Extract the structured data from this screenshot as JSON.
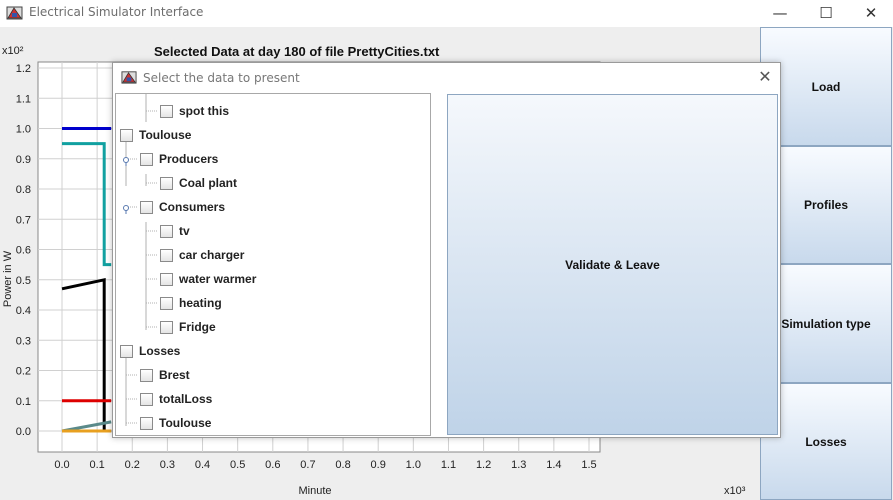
{
  "window": {
    "title": "Electrical Simulator Interface",
    "minimize": "—",
    "maximize": "☐",
    "close": "✕"
  },
  "plot": {
    "title": "Selected Data at day 180 of file PrettyCities.txt",
    "y_exponent": "x10²",
    "x_exponent": "x10³",
    "ylabel": "Power in W",
    "xlabel": "Minute",
    "y_ticks": [
      "1.2",
      "1.1",
      "1.0",
      "0.9",
      "0.8",
      "0.7",
      "0.6",
      "0.5",
      "0.4",
      "0.3",
      "0.2",
      "0.1",
      "0.0"
    ],
    "x_ticks": [
      "0.0",
      "0.1",
      "0.2",
      "0.3",
      "0.4",
      "0.5",
      "0.6",
      "0.7",
      "0.8",
      "0.9",
      "1.0",
      "1.1",
      "1.2",
      "1.3",
      "1.4",
      "1.5"
    ]
  },
  "chart_data": {
    "type": "line",
    "title": "Selected Data at day 180 of file PrettyCities.txt",
    "xlabel": "Minute",
    "ylabel": "Power in W",
    "x_scale": "x10^3",
    "y_scale": "x10^2",
    "xlim": [
      0,
      1.5
    ],
    "ylim": [
      0,
      1.2
    ],
    "grid": true,
    "series": [
      {
        "color": "#0000cc",
        "points": [
          [
            0,
            1.0
          ],
          [
            0.14,
            1.0
          ]
        ]
      },
      {
        "color": "#11a0a0",
        "points": [
          [
            0,
            0.95
          ],
          [
            0.12,
            0.95
          ],
          [
            0.12,
            0.55
          ],
          [
            0.14,
            0.55
          ]
        ]
      },
      {
        "color": "#000000",
        "points": [
          [
            0,
            0.47
          ],
          [
            0.12,
            0.5
          ],
          [
            0.12,
            0.0
          ],
          [
            0.14,
            0.0
          ]
        ]
      },
      {
        "color": "#dd0000",
        "points": [
          [
            0,
            0.1
          ],
          [
            0.14,
            0.1
          ]
        ]
      },
      {
        "color": "#5a8a8a",
        "points": [
          [
            0,
            0.0
          ],
          [
            0.14,
            0.03
          ]
        ]
      },
      {
        "color": "#e8a020",
        "points": [
          [
            0,
            0.0
          ],
          [
            0.14,
            0.0
          ]
        ]
      }
    ]
  },
  "sidebar": {
    "load": "Load",
    "profiles": "Profiles",
    "simulation_type": "Simulation type",
    "losses": "Losses"
  },
  "dialog": {
    "title": "Select the data to present",
    "close": "✕",
    "validate": "Validate & Leave",
    "tree": [
      {
        "label": "spot this",
        "level": 2
      },
      {
        "label": "Toulouse",
        "level": 0
      },
      {
        "label": "Producers",
        "level": 1
      },
      {
        "label": "Coal plant",
        "level": 2
      },
      {
        "label": "Consumers",
        "level": 1
      },
      {
        "label": "tv",
        "level": 2
      },
      {
        "label": "car charger",
        "level": 2
      },
      {
        "label": "water warmer",
        "level": 2
      },
      {
        "label": "heating",
        "level": 2
      },
      {
        "label": "Fridge",
        "level": 2
      },
      {
        "label": "Losses",
        "level": 0
      },
      {
        "label": "Brest",
        "level": 1
      },
      {
        "label": "totalLoss",
        "level": 1
      },
      {
        "label": "Toulouse",
        "level": 1
      }
    ]
  }
}
